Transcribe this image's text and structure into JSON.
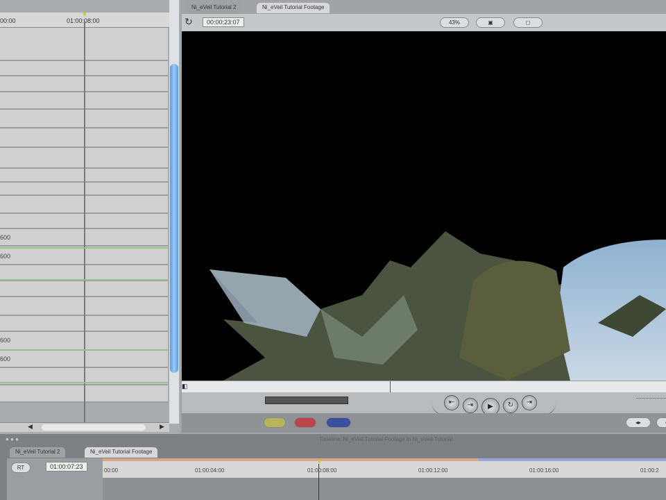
{
  "browser_panel": {
    "ruler_labels": [
      "00:00",
      "01:00:08:00"
    ],
    "row_values": [
      "600",
      "600",
      "600",
      "600"
    ]
  },
  "canvas": {
    "tabs": [
      "Ni_eVeil Tutorial 2",
      "Ni_eVeil Tutorial Footage"
    ],
    "active_tab": 1,
    "timecode": "00:00:23:07",
    "zoom": "43%",
    "view_label": "▣",
    "overlay_label": "◻"
  },
  "timeline": {
    "title": "Timeline: Ni_eVeil Tutorial Footage in Ni_eVeil Tutorial",
    "tabs": [
      "Ni_eVeil Tutorial 2",
      "Ni_eVeil Tutorial Footage"
    ],
    "active_tab": 1,
    "rt_label": "RT",
    "timecode": "01:00:07:23",
    "ruler_labels": [
      "00:00",
      "01:00:04:00",
      "01:00:08:00",
      "01:00:12:00",
      "01:00:16:00",
      "01:00:2"
    ]
  },
  "colors": {
    "scrollbar": "#5a9ae0",
    "render_bar_orange": "#d9a58a",
    "render_bar_blue": "#9aa6d8",
    "keyframe_line": "#8fc48a"
  }
}
